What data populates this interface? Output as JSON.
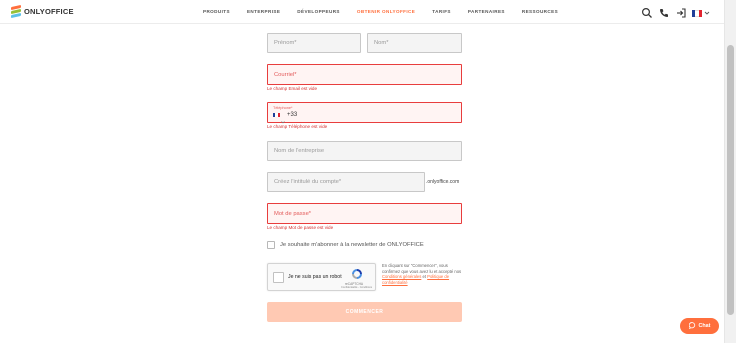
{
  "brand": {
    "name": "ONLYOFFICE"
  },
  "nav": {
    "items": [
      {
        "label": "PRODUITS"
      },
      {
        "label": "ENTERPRISE"
      },
      {
        "label": "DÉVELOPPEURS"
      },
      {
        "label": "OBTENIR ONLYOFFICE"
      },
      {
        "label": "TARIFS"
      },
      {
        "label": "PARTENAIRES"
      },
      {
        "label": "RESSOURCES"
      }
    ],
    "active_index": 3
  },
  "header_icons": [
    "search-icon",
    "phone-icon",
    "sign-in-icon",
    "flag-icon",
    "chevron-down-icon"
  ],
  "form": {
    "first_name_placeholder": "Prénom*",
    "last_name_placeholder": "Nom*",
    "email_placeholder": "Courriel*",
    "email_error": "Le champ Email est vide",
    "phone_label": "Téléphone*",
    "phone_code": "+33",
    "phone_error": "Le champ Téléphone est vide",
    "company_placeholder": "Nom de l'entreprise",
    "portal_placeholder": "Créez l'intitulé du compte*",
    "portal_suffix": ".onlyoffice.com",
    "password_placeholder": "Mot de passe*",
    "password_error": "Le champ Mot de passe est vide",
    "newsletter_label": "Je souhaite m'abonner à la newsletter de ONLYOFFICE",
    "submit_label": "COMMENCER"
  },
  "captcha": {
    "label": "Je ne suis pas un robot",
    "brand": "reCAPTCHA",
    "links": "Confidentialité - Conditions"
  },
  "terms": {
    "text_before": "En cliquant sur \"Commencer\", vous confirmez que vous avez lu et accepté nos ",
    "link1": "Conditions générales",
    "text_mid": " et ",
    "link2": "Politique de confidentialité"
  },
  "chat": {
    "label": "Chat"
  },
  "colors": {
    "accent": "#ff6f3d",
    "error": "#e83d3d",
    "submit_disabled": "#ffc9b3"
  }
}
